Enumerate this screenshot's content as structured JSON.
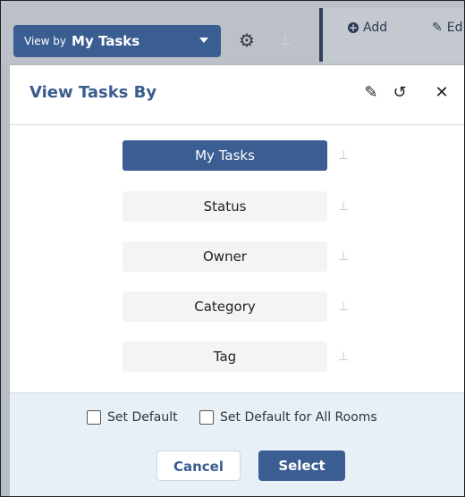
{
  "toolbar": {
    "view_by_prefix": "View by",
    "view_by_value": "My Tasks",
    "add_label": "Add",
    "edit_label": "Ed"
  },
  "dialog": {
    "title": "View Tasks By",
    "options": [
      {
        "label": "My Tasks",
        "active": true
      },
      {
        "label": "Status",
        "active": false
      },
      {
        "label": "Owner",
        "active": false
      },
      {
        "label": "Category",
        "active": false
      },
      {
        "label": "Tag",
        "active": false
      }
    ],
    "set_default_label": "Set Default",
    "set_default_all_label": "Set Default for All Rooms",
    "cancel_label": "Cancel",
    "select_label": "Select"
  },
  "icons": {
    "gear": "gear-icon",
    "pin": "pin-icon",
    "add": "plus-circle-icon",
    "edit": "pencil-icon",
    "history": "history-icon",
    "close": "close-icon"
  },
  "colors": {
    "accent": "#3a5d92",
    "title": "#3b5c8f",
    "footer_bg": "#e8f0f7",
    "option_bg": "#f4f4f4"
  }
}
